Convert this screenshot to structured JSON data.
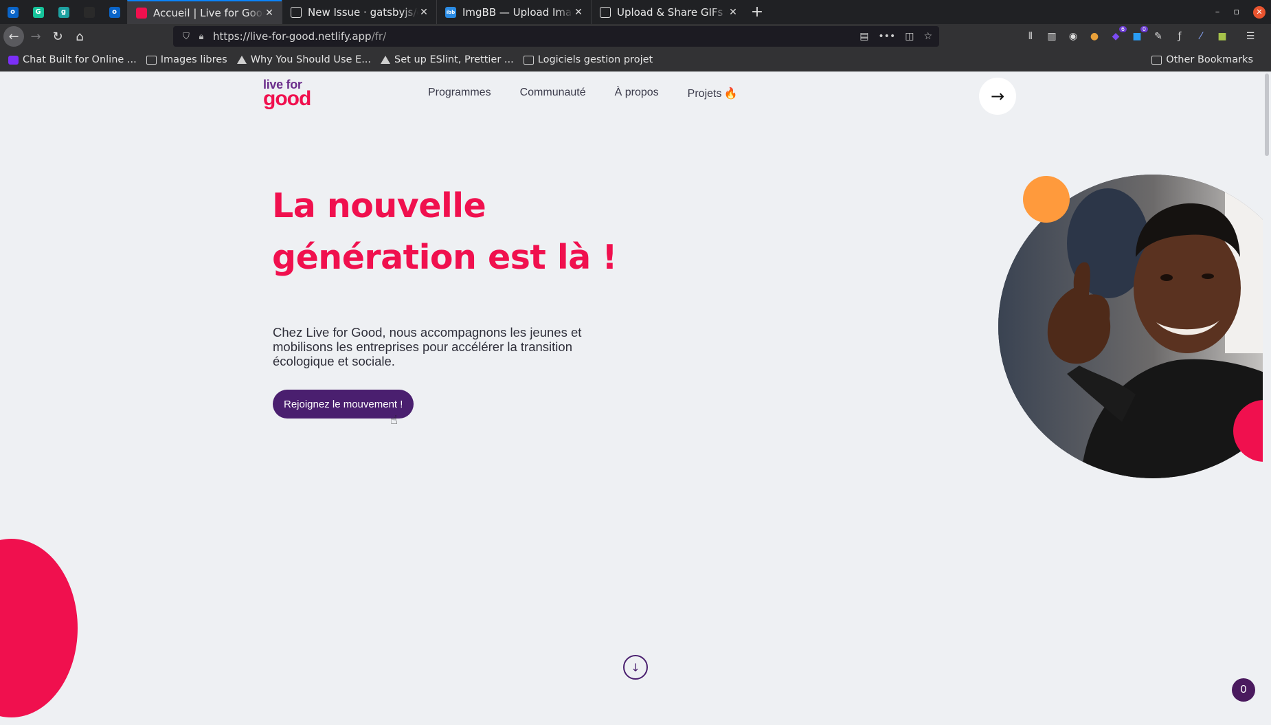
{
  "browser": {
    "pinned_tabs": [
      {
        "icon": "outlook-icon",
        "color": "#0a64c8",
        "glyph": "o"
      },
      {
        "icon": "grammarly-icon",
        "color": "#15c39a",
        "glyph": "G"
      },
      {
        "icon": "g-app-icon",
        "color": "#1da1a1",
        "glyph": "g"
      },
      {
        "icon": "dark-app-icon",
        "color": "#2a2a2a",
        "glyph": ""
      },
      {
        "icon": "outlook-icon",
        "color": "#0a64c8",
        "glyph": "o"
      }
    ],
    "tabs": [
      {
        "title": "Accueil | Live for Good",
        "active": true,
        "icon": "live-for-good-icon",
        "color": "#f0104e",
        "glyph": ""
      },
      {
        "title": "New Issue · gatsbyjs/gatsby",
        "active": false,
        "icon": "github-icon",
        "color": "#ffffff",
        "glyph": ""
      },
      {
        "title": "ImgBB — Upload Image",
        "active": false,
        "icon": "imgbb-icon",
        "color": "#2a8be4",
        "glyph": "ibb"
      },
      {
        "title": "Upload & Share GIFs Online",
        "active": false,
        "icon": "gif-icon",
        "color": "#ffffff",
        "glyph": ""
      }
    ],
    "url_host": "https://live-for-good.netlify.app",
    "url_path": "/fr/",
    "toolbar_badges": {
      "ext1": "6",
      "ext2": "0"
    },
    "bookmarks": [
      {
        "label": "Chat Built for Online ...",
        "icon": "purple"
      },
      {
        "label": "Images libres",
        "icon": "folder"
      },
      {
        "label": "Why You Should Use E...",
        "icon": "tri"
      },
      {
        "label": "Set up ESlint, Prettier ...",
        "icon": "tri"
      },
      {
        "label": "Logiciels gestion projet",
        "icon": "folder"
      }
    ],
    "other_bookmarks": "Other Bookmarks"
  },
  "site": {
    "logo_line1": "live for",
    "logo_line2": "good",
    "nav": [
      {
        "label": "Programmes"
      },
      {
        "label": "Communauté"
      },
      {
        "label": "À propos"
      },
      {
        "label": "Projets",
        "suffix": "🔥"
      }
    ],
    "hero": {
      "headline_line1": "La nouvelle",
      "headline_line2": "génération est là !",
      "lead": "Chez Live for Good, nous accompagnons les jeunes et mobilisons les entreprises pour accélérer la transition écologique et sociale.",
      "cta_label": "Rejoignez le mouvement !"
    },
    "counter_badge": "0",
    "colors": {
      "brand_pink": "#f0104e",
      "brand_purple": "#4a1f6f",
      "accent_orange": "#ff9a3c",
      "page_bg": "#eef0f3"
    }
  }
}
